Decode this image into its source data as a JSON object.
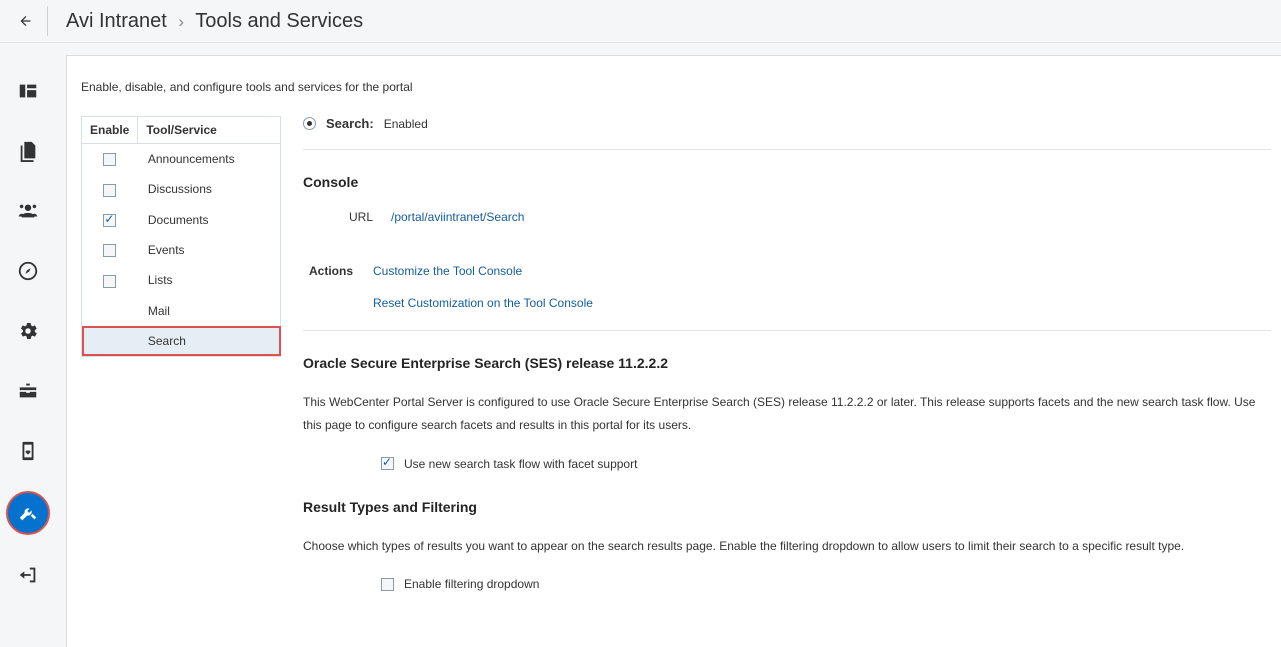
{
  "breadcrumb": {
    "root": "Avi Intranet",
    "page": "Tools and Services"
  },
  "intro": "Enable, disable, and configure tools and services for the portal",
  "table": {
    "col1": "Enable",
    "col2": "Tool/Service",
    "rows": [
      {
        "name": "Announcements",
        "checked": false,
        "hasCheckbox": true
      },
      {
        "name": "Discussions",
        "checked": false,
        "hasCheckbox": true
      },
      {
        "name": "Documents",
        "checked": true,
        "hasCheckbox": true
      },
      {
        "name": "Events",
        "checked": false,
        "hasCheckbox": true
      },
      {
        "name": "Lists",
        "checked": false,
        "hasCheckbox": true
      },
      {
        "name": "Mail",
        "checked": false,
        "hasCheckbox": false
      },
      {
        "name": "Search",
        "checked": false,
        "hasCheckbox": false,
        "selected": true
      }
    ]
  },
  "status": {
    "label": "Search:",
    "value": "Enabled"
  },
  "console": {
    "title": "Console",
    "urlLabel": "URL",
    "urlValue": "/portal/aviintranet/Search",
    "actionsLabel": "Actions",
    "action1": "Customize the Tool Console",
    "action2": "Reset Customization on the Tool Console"
  },
  "ses": {
    "title": "Oracle Secure Enterprise Search (SES) release 11.2.2.2",
    "desc": "This WebCenter Portal Server is configured to use Oracle Secure Enterprise Search (SES) release 11.2.2.2 or later. This release supports facets and the new search task flow. Use this page to configure search facets and results in this portal for its users.",
    "checkbox": "Use new search task flow with facet support"
  },
  "resultTypes": {
    "title": "Result Types and Filtering",
    "desc": "Choose which types of results you want to appear on the search results page. Enable the filtering dropdown to allow users to limit their search to a specific result type.",
    "checkbox": "Enable filtering dropdown"
  }
}
